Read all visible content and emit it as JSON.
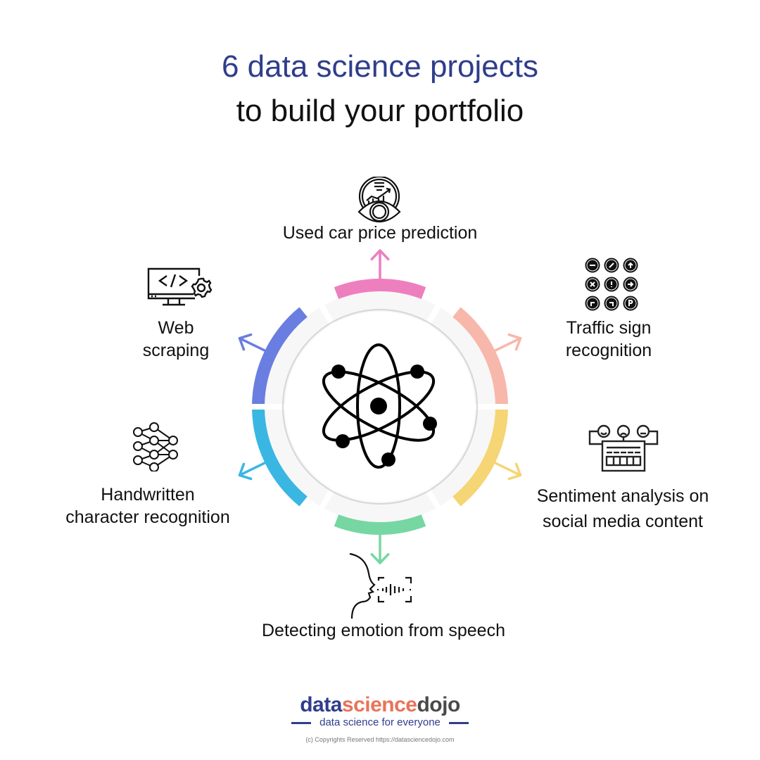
{
  "title": {
    "line1": "6 data science projects",
    "line2": "to build your portfolio"
  },
  "colors": {
    "title_accent": "#2f3d8c",
    "pink": "#ee7fbf",
    "salmon": "#f7b7aa",
    "yellow": "#f5d574",
    "green": "#76d7a2",
    "cyan": "#3ab6e3",
    "blue": "#6a7de0"
  },
  "center_icon": "atom-icon",
  "projects": [
    {
      "label": "Used car price prediction",
      "icon": "eye-chart-icon",
      "color": "pink"
    },
    {
      "label": "Traffic sign recognition",
      "line1": "Traffic sign",
      "line2": "recognition",
      "icon": "traffic-signs-icon",
      "color": "salmon"
    },
    {
      "label": "Sentiment analysis on social media content",
      "line1": "Sentiment analysis on",
      "line2": "social media content",
      "icon": "sentiment-board-icon",
      "color": "yellow"
    },
    {
      "label": "Detecting emotion from speech",
      "icon": "voice-face-icon",
      "color": "green"
    },
    {
      "label": "Handwritten character recognition",
      "line1": "Handwritten",
      "line2": "character recognition",
      "icon": "neural-network-icon",
      "color": "cyan"
    },
    {
      "label": "Web scraping",
      "line1": "Web",
      "line2": "scraping",
      "icon": "code-monitor-icon",
      "color": "blue"
    }
  ],
  "footer": {
    "logo_part1": "data",
    "logo_part2": "science",
    "logo_part3": "dojo",
    "tagline": "data science for everyone",
    "copyright": "(c) Copyrights Reserved  https://datasciencedojo.com"
  }
}
